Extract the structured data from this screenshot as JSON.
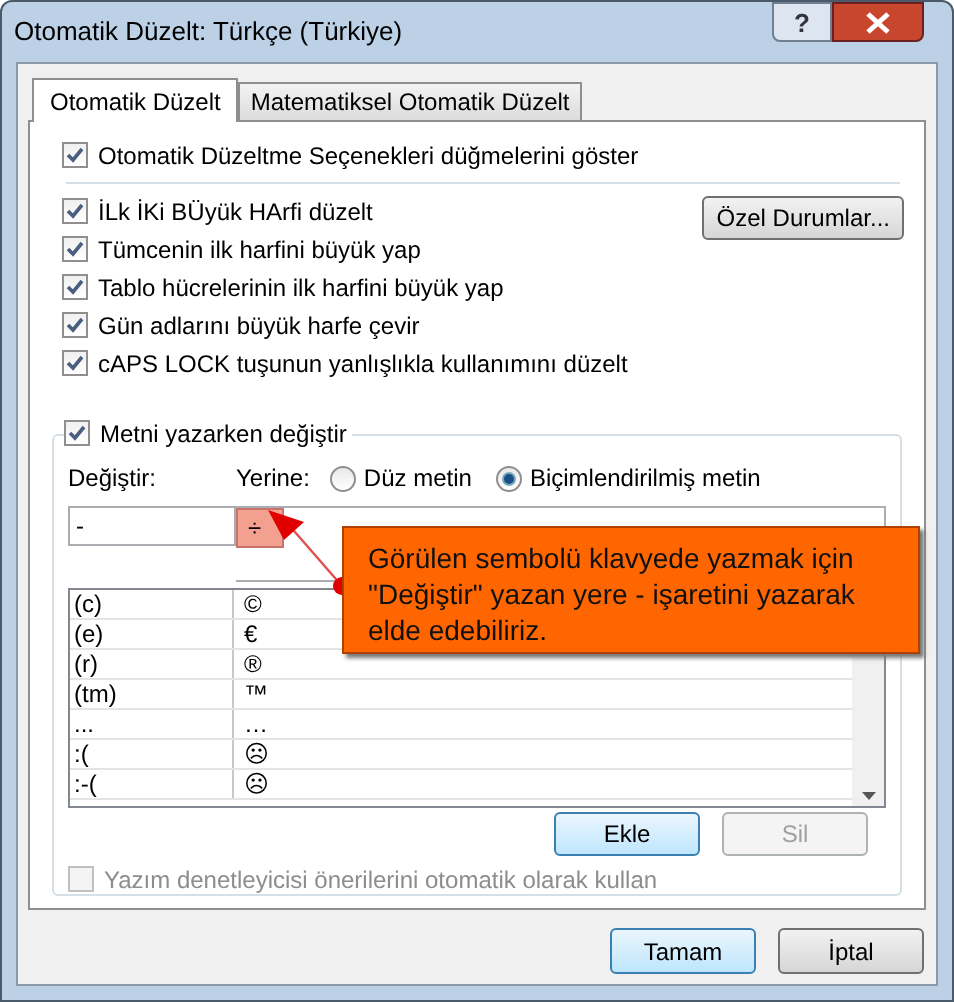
{
  "window": {
    "title": "Otomatik Düzelt: Türkçe (Türkiye)",
    "help_button": "?"
  },
  "tabs": [
    {
      "label": "Otomatik Düzelt",
      "selected": true
    },
    {
      "label": "Matematiksel Otomatik Düzelt",
      "selected": false
    }
  ],
  "show_buttons_option": {
    "label": "Otomatik Düzeltme Seçenekleri düğmelerini göster",
    "checked": true
  },
  "options": [
    {
      "label": "İLk İKi BÜyük HArfi düzelt",
      "checked": true
    },
    {
      "label": "Tümcenin ilk harfini büyük yap",
      "checked": true
    },
    {
      "label": "Tablo hücrelerinin ilk harfini büyük yap",
      "checked": true
    },
    {
      "label": "Gün adlarını büyük harfe çevir",
      "checked": true
    },
    {
      "label": "cAPS LOCK tuşunun yanlışlıkla kullanımını düzelt",
      "checked": true
    }
  ],
  "exceptions_button": "Özel Durumlar...",
  "replace_group": {
    "label": "Metni yazarken değiştir",
    "checked": true
  },
  "replace_label": "Değiştir:",
  "with_label": "Yerine:",
  "format_options": [
    {
      "label": "Düz metin",
      "selected": false
    },
    {
      "label": "Biçimlendirilmiş metin",
      "selected": true
    }
  ],
  "replace_value": "-",
  "with_value": "÷",
  "entries": [
    {
      "replace": "(c)",
      "with": "©"
    },
    {
      "replace": "(e)",
      "with": "€"
    },
    {
      "replace": "(r)",
      "with": "®"
    },
    {
      "replace": "(tm)",
      "with": "™"
    },
    {
      "replace": "...",
      "with": "…"
    },
    {
      "replace": ":(",
      "with": "☹"
    },
    {
      "replace": ":-(",
      "with": "☹"
    }
  ],
  "add_button": {
    "label": "Ekle",
    "disabled": false
  },
  "delete_button": {
    "label": "Sil",
    "disabled": true
  },
  "spellcheck_option": {
    "label": "Yazım denetleyicisi önerilerini otomatik olarak kullan",
    "checked": false,
    "disabled": true
  },
  "callout": {
    "text": "Görülen sembolü klavyede yazmak için \"Değiştir\" yazan yere - işaretini yazarak elde edebiliriz."
  },
  "footer_buttons": [
    {
      "label": "Tamam",
      "default": true
    },
    {
      "label": "İptal",
      "default": false
    }
  ]
}
